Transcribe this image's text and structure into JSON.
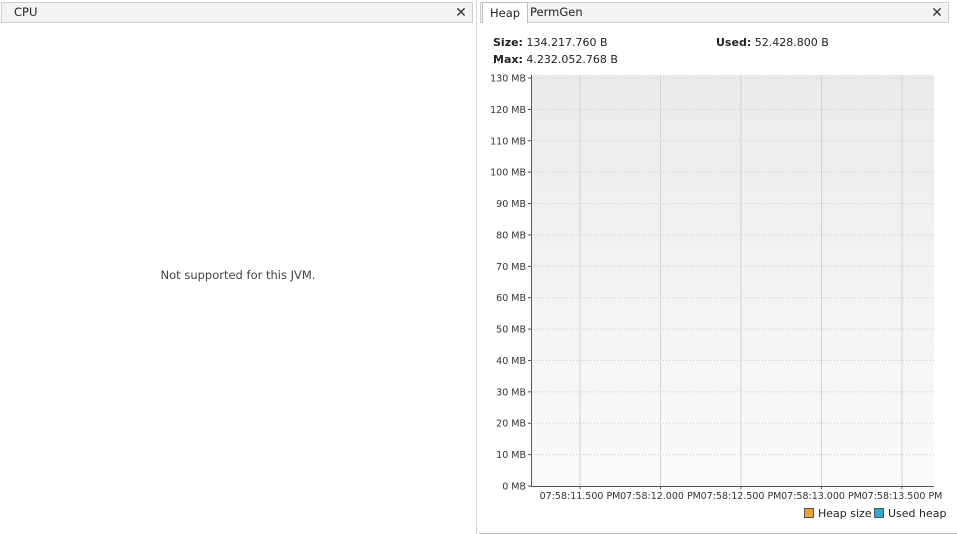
{
  "left_panel": {
    "tab_label": "CPU",
    "close_glyph": "✕",
    "message": "Not supported for this JVM."
  },
  "right_panel": {
    "tabs": [
      {
        "label": "Heap",
        "active": true
      },
      {
        "label": "PermGen",
        "active": false
      }
    ],
    "close_glyph": "✕",
    "stats": {
      "size_label": "Size:",
      "size_value": "134.217.760 B",
      "used_label": "Used:",
      "used_value": "52.428.800 B",
      "max_label": "Max:",
      "max_value": "4.232.052.768 B"
    }
  },
  "chart_data": {
    "type": "area",
    "title": "",
    "xlabel": "",
    "ylabel": "",
    "y_ticks": [
      "0 MB",
      "10 MB",
      "20 MB",
      "30 MB",
      "40 MB",
      "50 MB",
      "60 MB",
      "70 MB",
      "80 MB",
      "90 MB",
      "100 MB",
      "110 MB",
      "120 MB",
      "130 MB"
    ],
    "ylim": [
      0,
      130
    ],
    "x_ticks": [
      "07:58:11.500 PM",
      "07:58:12.000 PM",
      "07:58:12.500 PM",
      "07:58:13.000 PM",
      "07:58:13.500 PM"
    ],
    "grid": true,
    "legend_position": "bottom-right",
    "series": [
      {
        "name": "Heap size",
        "color": "#f0a030",
        "values": []
      },
      {
        "name": "Used heap",
        "color": "#2aa8d8",
        "values": []
      }
    ]
  }
}
